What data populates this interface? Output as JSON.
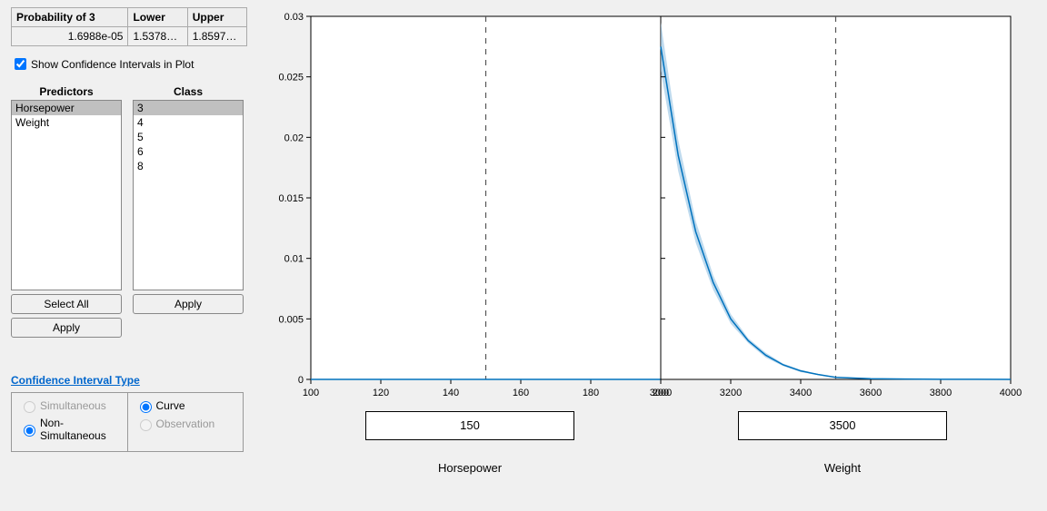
{
  "table": {
    "headers": [
      "Probability of 3",
      "Lower",
      "Upper"
    ],
    "values": [
      "1.6988e-05",
      "1.5378e…",
      "1.8597e…"
    ]
  },
  "checkbox": {
    "label": "Show Confidence Intervals in Plot",
    "checked": true
  },
  "predictors": {
    "label": "Predictors",
    "items": [
      "Horsepower",
      "Weight"
    ],
    "selected_index": 0,
    "select_all": "Select All",
    "apply": "Apply"
  },
  "class": {
    "label": "Class",
    "items": [
      "3",
      "4",
      "5",
      "6",
      "8"
    ],
    "selected_index": 0,
    "apply": "Apply"
  },
  "ci": {
    "title": "Confidence Interval Type",
    "left": [
      {
        "label": "Simultaneous",
        "checked": false,
        "disabled": true
      },
      {
        "label": "Non-Simultaneous",
        "checked": true,
        "disabled": false
      }
    ],
    "right": [
      {
        "label": "Curve",
        "checked": true,
        "disabled": false
      },
      {
        "label": "Observation",
        "checked": false,
        "disabled": true
      }
    ]
  },
  "editboxes": {
    "horsepower": "150",
    "weight": "3500"
  },
  "axis_titles": {
    "horsepower": "Horsepower",
    "weight": "Weight"
  },
  "chart_data": {
    "type": "line",
    "subplots": [
      {
        "xlabel": "Horsepower",
        "x_range": [
          100,
          200
        ],
        "x_reference": 150,
        "x_ticks": [
          100,
          120,
          140,
          160,
          180,
          200
        ],
        "flat_value": 0
      },
      {
        "xlabel": "Weight",
        "x_range": [
          3000,
          4000
        ],
        "x_reference": 3500,
        "x_ticks": [
          3000,
          3200,
          3400,
          3600,
          3800,
          4000
        ],
        "curve": {
          "x": [
            3000,
            3050,
            3100,
            3150,
            3200,
            3250,
            3300,
            3350,
            3400,
            3450,
            3500,
            3600,
            3700,
            3800,
            3900,
            4000
          ],
          "y": [
            0.0275,
            0.0185,
            0.0122,
            0.008,
            0.005,
            0.0032,
            0.002,
            0.0012,
            0.0007,
            0.0004,
            0.00017,
            6e-05,
            3e-05,
            1e-05,
            5e-06,
            2e-06
          ],
          "ci_lower": [
            0.0255,
            0.0172,
            0.0113,
            0.0074,
            0.0046,
            0.003,
            0.0018,
            0.0011,
            0.0006,
            0.00035,
            0.00015,
            5e-05,
            2.5e-05,
            9e-06,
            4e-06,
            1.5e-06
          ],
          "ci_upper": [
            0.0295,
            0.0198,
            0.0131,
            0.0086,
            0.0054,
            0.0034,
            0.0022,
            0.0013,
            0.0008,
            0.00045,
            0.00019,
            7e-05,
            3.5e-05,
            1.1e-05,
            6e-06,
            2.5e-06
          ]
        }
      }
    ],
    "y_range": [
      0,
      0.03
    ],
    "y_ticks": [
      0,
      0.005,
      0.01,
      0.015,
      0.02,
      0.025,
      0.03
    ],
    "ylabel": ""
  }
}
